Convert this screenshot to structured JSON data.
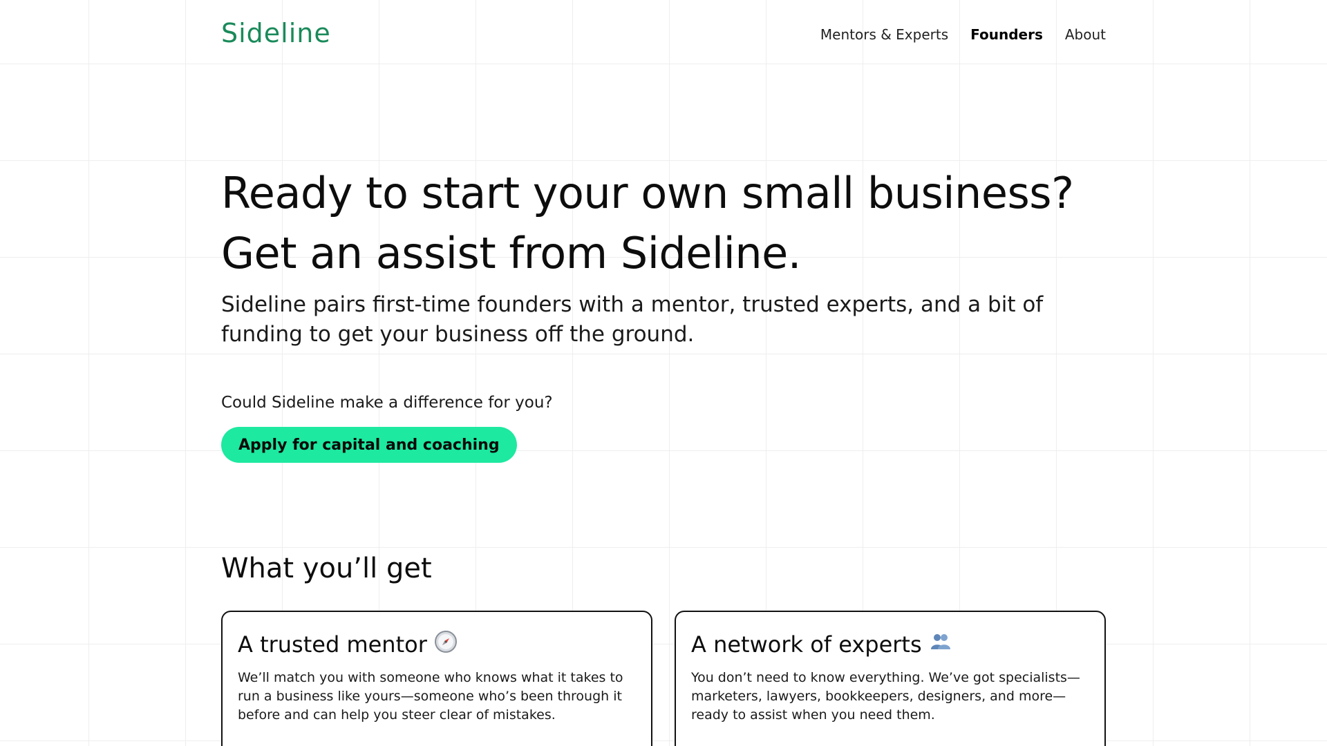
{
  "header": {
    "logo": "Sideline",
    "nav": [
      {
        "label": "Mentors & Experts",
        "active": false
      },
      {
        "label": "Founders",
        "active": true
      },
      {
        "label": "About",
        "active": false
      }
    ]
  },
  "hero": {
    "headline_line1": "Ready to start your own small business?",
    "headline_line2": "Get an assist from Sideline.",
    "lead": "Sideline pairs first-time founders with a mentor, trusted experts, and a bit of funding to get your business off the ground."
  },
  "cta": {
    "prompt": "Could Sideline make a difference for you?",
    "button_label": "Apply for capital and coaching",
    "button_color": "#1de9a0"
  },
  "features": {
    "title": "What you’ll get",
    "cards": [
      {
        "title": "A trusted mentor",
        "icon": "compass-icon",
        "body": "We’ll match you with someone who knows what it takes to run a business like yours—someone who’s been through it before and can help you steer clear of mistakes."
      },
      {
        "title": "A network of experts",
        "icon": "people-icon",
        "body": "You don’t need to know everything. We’ve got specialists—marketers, lawyers, bookkeepers, designers, and more—ready to assist when you need them."
      }
    ]
  },
  "colors": {
    "brand": "#1a8a5a",
    "accent": "#1de9a0",
    "text": "#111111"
  }
}
